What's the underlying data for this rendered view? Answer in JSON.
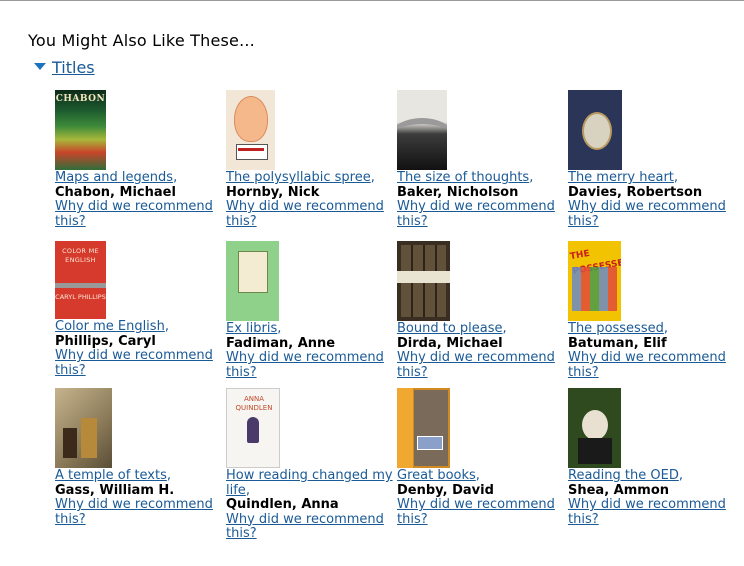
{
  "heading": "You Might Also Like These...",
  "section_toggle": {
    "label": "Titles"
  },
  "why_label": "Why did we recommend this?",
  "items": [
    {
      "title": "Maps and legends",
      "author": "Chabon, Michael",
      "cover_text": "CHABON"
    },
    {
      "title": "The polysyllabic spree",
      "author": "Hornby, Nick"
    },
    {
      "title": "The size of thoughts",
      "author": "Baker, Nicholson"
    },
    {
      "title": "The merry heart",
      "author": "Davies, Robertson"
    },
    {
      "title": "Color me English",
      "author": "Phillips, Caryl",
      "cover_text": "COLOR ME ENGLISH",
      "cover_text2": "CARYL PHILLIPS"
    },
    {
      "title": "Ex libris",
      "author": "Fadiman, Anne"
    },
    {
      "title": "Bound to please",
      "author": "Dirda, Michael"
    },
    {
      "title": "The possessed",
      "author": "Batuman, Elif",
      "cover_text": "THE POSSESSED"
    },
    {
      "title": "A temple of texts",
      "author": "Gass, William H."
    },
    {
      "title": "How reading changed my life",
      "author": "Quindlen, Anna",
      "cover_text": "ANNA QUINDLEN"
    },
    {
      "title": "Great books",
      "author": "Denby, David"
    },
    {
      "title": "Reading the OED",
      "author": "Shea, Ammon"
    }
  ],
  "colors": {
    "link": "#1a5a96",
    "toggle_arrow": "#1e73be"
  }
}
